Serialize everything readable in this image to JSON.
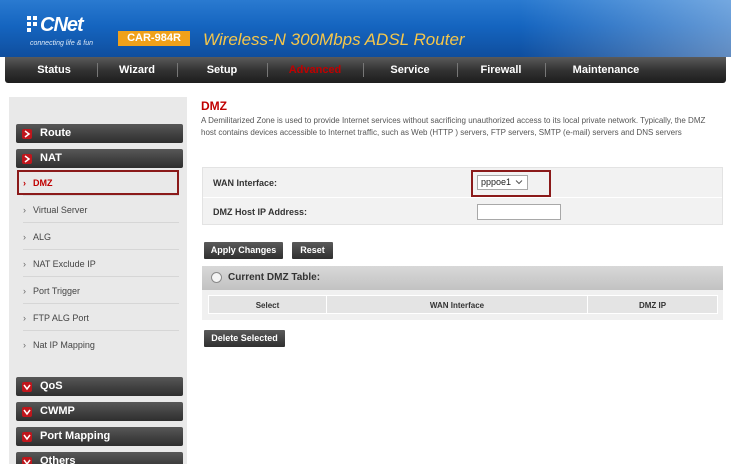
{
  "header": {
    "logo_text": "CNet",
    "logo_tagline": "connecting life & fun",
    "model": "CAR-984R",
    "product_title": "Wireless-N 300Mbps ADSL Router"
  },
  "nav": {
    "items": [
      {
        "label": "Status"
      },
      {
        "label": "Wizard"
      },
      {
        "label": "Setup"
      },
      {
        "label": "Advanced"
      },
      {
        "label": "Service"
      },
      {
        "label": "Firewall"
      },
      {
        "label": "Maintenance"
      }
    ],
    "active": "Advanced"
  },
  "sidebar": {
    "route": "Route",
    "nat": "NAT",
    "nat_items": [
      {
        "label": "DMZ"
      },
      {
        "label": "Virtual Server"
      },
      {
        "label": "ALG"
      },
      {
        "label": "NAT Exclude IP"
      },
      {
        "label": "Port Trigger"
      },
      {
        "label": "FTP ALG Port"
      },
      {
        "label": "Nat IP Mapping"
      }
    ],
    "active_item": "DMZ",
    "qos": "QoS",
    "cwmp": "CWMP",
    "port_mapping": "Port Mapping",
    "others": "Others"
  },
  "main": {
    "title": "DMZ",
    "description": "A Demilitarized Zone is used to provide Internet services without sacrificing unauthorized access to its local private network. Typically, the DMZ host contains devices accessible to Internet traffic, such as Web (HTTP ) servers, FTP servers, SMTP (e-mail) servers and DNS servers",
    "wan_interface_label": "WAN Interface:",
    "wan_interface_value": "pppoe1",
    "dmz_host_label": "DMZ Host IP Address:",
    "dmz_host_value": "",
    "apply_button": "Apply Changes",
    "reset_button": "Reset",
    "table_title": "Current DMZ Table:",
    "table_columns": [
      "Select",
      "WAN Interface",
      "DMZ IP"
    ],
    "delete_button": "Delete Selected"
  },
  "colors": {
    "brand_blue": "#1565c0",
    "accent_red": "#c00000",
    "badge_orange": "#f0a11a"
  }
}
